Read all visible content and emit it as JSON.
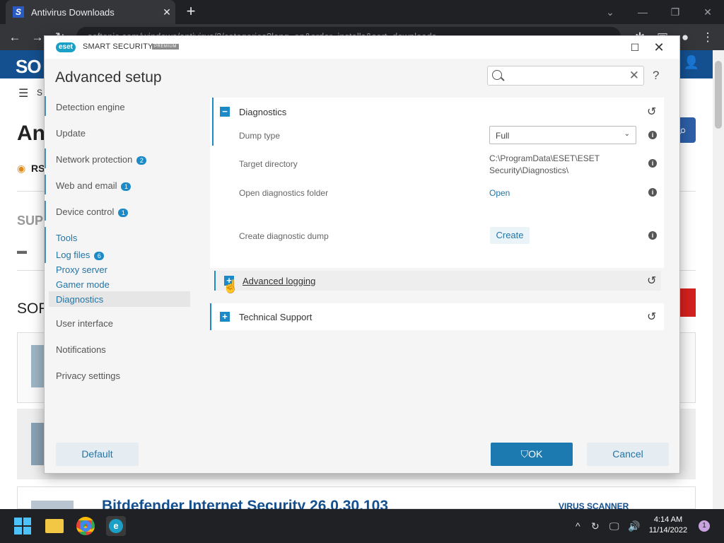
{
  "browser": {
    "tab_title": "Antivirus Downloads",
    "tab_favicon_letter": "S",
    "url_partial": "softonic.com/windows/antivirus/2/categories?lang=en&order=installs&sort=downloads"
  },
  "webpage": {
    "logo": "SO",
    "partial_headings": {
      "h1": "An",
      "rss": "RS",
      "sub": "SUP",
      "sort": "SOR",
      "menu": "S"
    },
    "bottom_item_title": "Bitdefender Internet Security 26.0.30.103",
    "bottom_item_category": "VIRUS SCANNER"
  },
  "dialog": {
    "brand_logo": "eset",
    "product": "SMART SECURITY",
    "edition": "PREMIUM",
    "heading": "Advanced setup",
    "search_value": "",
    "help": "?",
    "sidebar": [
      {
        "label": "Detection engine",
        "badge": ""
      },
      {
        "label": "Update",
        "badge": ""
      },
      {
        "label": "Network protection",
        "badge": "2"
      },
      {
        "label": "Web and email",
        "badge": "1"
      },
      {
        "label": "Device control",
        "badge": "1"
      },
      {
        "label": "Tools",
        "badge": ""
      },
      {
        "label": "User interface",
        "badge": ""
      },
      {
        "label": "Notifications",
        "badge": ""
      },
      {
        "label": "Privacy settings",
        "badge": ""
      }
    ],
    "tools_sub": [
      {
        "label": "Log files",
        "badge": "6"
      },
      {
        "label": "Proxy server"
      },
      {
        "label": "Gamer mode"
      },
      {
        "label": "Diagnostics"
      }
    ],
    "sections": {
      "diagnostics": {
        "title": "Diagnostics",
        "dump_type_label": "Dump type",
        "dump_type_value": "Full",
        "target_dir_label": "Target directory",
        "target_dir_value": "C:\\ProgramData\\ESET\\ESET Security\\Diagnostics\\",
        "open_folder_label": "Open diagnostics folder",
        "open_link": "Open",
        "create_dump_label": "Create diagnostic dump",
        "create_button": "Create"
      },
      "advanced_logging": {
        "title": "Advanced logging"
      },
      "technical_support": {
        "title": "Technical Support"
      }
    },
    "buttons": {
      "default": "Default",
      "ok": "OK",
      "cancel": "Cancel"
    }
  },
  "taskbar": {
    "time": "4:14 AM",
    "date": "11/14/2022",
    "notifications": "1"
  }
}
